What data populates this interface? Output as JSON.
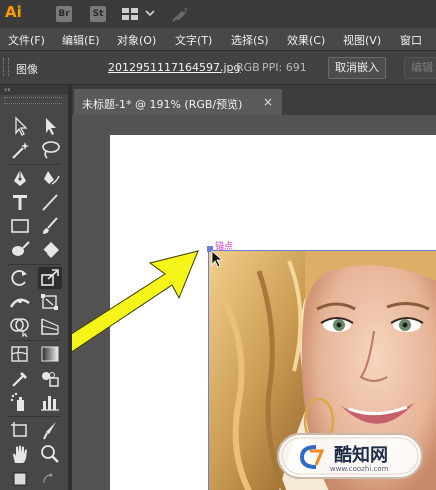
{
  "app": {
    "logo": "Ai",
    "badges": [
      "Br",
      "St"
    ],
    "icons": [
      "workspace-grid-icon",
      "chevron-down-icon",
      "gpu-rocket-icon"
    ]
  },
  "menubar": {
    "items": [
      "文件(F)",
      "编辑(E)",
      "对象(O)",
      "文字(T)",
      "选择(S)",
      "效果(C)",
      "视图(V)",
      "窗口"
    ]
  },
  "control_bar": {
    "label": "图像",
    "file_name": "2012951117164597.jpg",
    "color_mode": "RGB",
    "ppi": "PPI: 691",
    "unembed_button": "取消嵌入",
    "edit_button": "编辑"
  },
  "tools_panel": {
    "collapse_glyph": "‹‹",
    "tools": [
      "selection-tool-icon",
      "direct-selection-tool-icon",
      "magic-wand-tool-icon",
      "lasso-tool-icon",
      "pen-tool-icon",
      "curvature-tool-icon",
      "type-tool-icon",
      "line-segment-tool-icon",
      "rectangle-tool-icon",
      "paintbrush-tool-icon",
      "blob-brush-tool-icon",
      "eraser-tool-icon",
      "rotate-tool-icon",
      "scale-tool-icon",
      "width-tool-icon",
      "free-transform-tool-icon",
      "shape-builder-tool-icon",
      "perspective-grid-tool-icon",
      "mesh-tool-icon",
      "gradient-tool-icon",
      "eyedropper-tool-icon",
      "blend-tool-icon",
      "symbol-sprayer-tool-icon",
      "column-graph-tool-icon",
      "artboard-tool-icon",
      "slice-tool-icon",
      "hand-tool-icon",
      "zoom-tool-icon"
    ],
    "selected_tool": "scale-tool-icon"
  },
  "document": {
    "tab_label": "未标题-1* @ 191% (RGB/预览)",
    "tab_close": "×",
    "anchor_label": "锚点",
    "watermark_text": "酷知网",
    "watermark_url": "www.coozhi.com"
  },
  "colors": {
    "app_bar": "#3b3b3b",
    "panel": "#474747",
    "ai_orange": "#ff9a00",
    "selection_blue": "#6b7fd6",
    "anchor_magenta": "#d13fd1",
    "annotation_arrow": "#f5f51a"
  }
}
